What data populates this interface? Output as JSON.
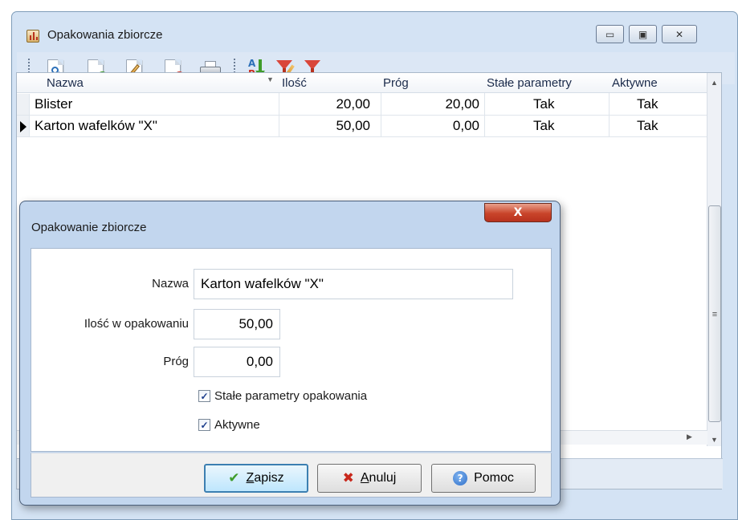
{
  "window": {
    "title": "Opakowania zbiorcze",
    "controls": {
      "minimize": "▭",
      "maximize": "▣",
      "close": "✕"
    }
  },
  "toolbar": {
    "items": [
      "preview-icon",
      "add-icon",
      "edit-icon",
      "delete-icon",
      "print-icon",
      "sort-az-icon",
      "filter-edit-icon",
      "filter-icon"
    ]
  },
  "grid": {
    "columns": [
      "Nazwa",
      "Ilość",
      "Próg",
      "Stałe parametry",
      "Aktywne"
    ],
    "rows": [
      {
        "nazwa": "Blister",
        "ilosc": "20,00",
        "prog": "20,00",
        "stale": "Tak",
        "aktywne": "Tak",
        "current": false
      },
      {
        "nazwa": "Karton wafelków \"X\"",
        "ilosc": "50,00",
        "prog": "0,00",
        "stale": "Tak",
        "aktywne": "Tak",
        "current": true
      }
    ]
  },
  "dialog": {
    "title": "Opakowanie zbiorcze",
    "close_glyph": "X",
    "fields": {
      "nazwa_label": "Nazwa",
      "nazwa_value": "Karton wafelków \"X\"",
      "ilosc_label": "Ilość w opakowaniu",
      "ilosc_value": "50,00",
      "prog_label": "Próg",
      "prog_value": "0,00"
    },
    "checkboxes": {
      "stale_label": "Stałe parametry opakowania",
      "stale_checked": true,
      "aktywne_label": "Aktywne",
      "aktywne_checked": true
    },
    "buttons": {
      "zapisz_first": "Z",
      "zapisz_rest": "apisz",
      "anuluj_first": "A",
      "anuluj_rest": "nuluj",
      "pomoc": "Pomoc"
    }
  },
  "colors": {
    "accent": "#3c7fb1",
    "save_icon": "#3f9c2b",
    "cancel_icon": "#c8281c",
    "help_icon": "#2f6fc9"
  }
}
